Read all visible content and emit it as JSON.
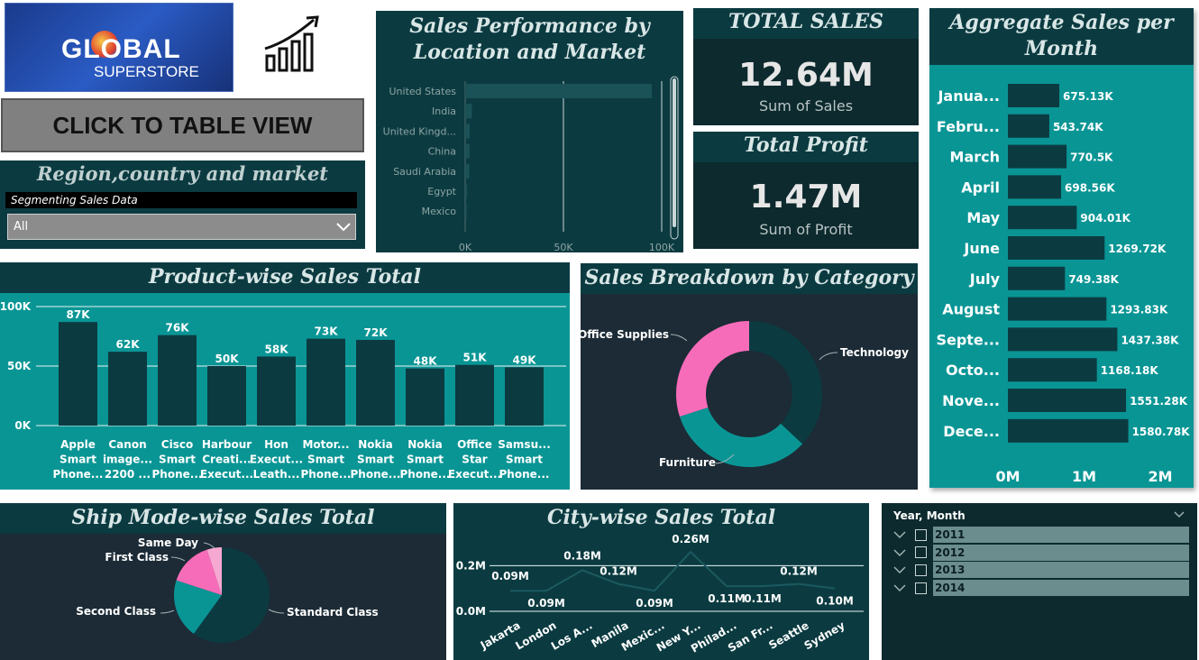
{
  "logo": {
    "line1": "GLOBAL",
    "line2": "SUPERSTORE",
    "icon": "growth-chart-icon"
  },
  "table_button": {
    "label": "CLICK TO TABLE VIEW"
  },
  "region_filter": {
    "title": "Region,country and market",
    "subtitle": "Segmenting Sales Data",
    "selected": "All"
  },
  "location_chart": {
    "title": "Sales Performance by Location and Market",
    "chart_data": {
      "type": "bar",
      "orientation": "horizontal",
      "categories": [
        "United States",
        "India",
        "United Kingd...",
        "China",
        "Saudi Arabia",
        "Egypt",
        "Mexico"
      ],
      "values": [
        95000,
        3400,
        2300,
        2200,
        2100,
        1000,
        800
      ],
      "xticks": [
        "0K",
        "50K",
        "100K"
      ],
      "xlim": [
        0,
        100000
      ]
    }
  },
  "total_sales": {
    "title": "TOTAL SALES",
    "value": "12.64M",
    "caption": "Sum of Sales"
  },
  "total_profit": {
    "title": "Total Profit",
    "value": "1.47M",
    "caption": "Sum of Profit"
  },
  "monthly_chart": {
    "title": "Aggregate Sales per Month",
    "chart_data": {
      "type": "bar",
      "orientation": "horizontal",
      "categories": [
        "Janua...",
        "Febru...",
        "March",
        "April",
        "May",
        "June",
        "July",
        "August",
        "Septe...",
        "Octo...",
        "Nove...",
        "Dece..."
      ],
      "values": [
        675130,
        543740,
        770500,
        698560,
        904010,
        1269720,
        749380,
        1293830,
        1437380,
        1168180,
        1551280,
        1580780
      ],
      "labels": [
        "675.13K",
        "543.74K",
        "770.5K",
        "698.56K",
        "904.01K",
        "1269.72K",
        "749.38K",
        "1293.83K",
        "1437.38K",
        "1168.18K",
        "1551.28K",
        "1580.78K"
      ],
      "xticks": [
        "0M",
        "1M",
        "2M"
      ],
      "xlim": [
        0,
        2000000
      ]
    }
  },
  "product_chart": {
    "title": "Product-wise Sales Total",
    "chart_data": {
      "type": "bar",
      "categories": [
        [
          "Apple",
          "Smart",
          "Phone..."
        ],
        [
          "Canon",
          "image...",
          "2200 ..."
        ],
        [
          "Cisco",
          "Smart",
          "Phone..."
        ],
        [
          "Harbour",
          "Creati...",
          "Execut..."
        ],
        [
          "Hon",
          "Execut...",
          "Leath..."
        ],
        [
          "Motor...",
          "Smart",
          "Phone..."
        ],
        [
          "Nokia",
          "Smart",
          "Phone..."
        ],
        [
          "Nokia",
          "Smart",
          "Phone..."
        ],
        [
          "Office",
          "Star",
          "Execut..."
        ],
        [
          "Samsu...",
          "Smart",
          "Phone..."
        ]
      ],
      "values": [
        87,
        62,
        76,
        50,
        58,
        73,
        72,
        48,
        51,
        49
      ],
      "labels": [
        "87K",
        "62K",
        "76K",
        "50K",
        "58K",
        "73K",
        "72K",
        "48K",
        "51K",
        "49K"
      ],
      "yticks": [
        "100K",
        "50K",
        "0K"
      ],
      "ylim": [
        0,
        100
      ]
    }
  },
  "category_chart": {
    "title": "Sales Breakdown by Category",
    "chart_data": {
      "type": "pie",
      "donut": true,
      "slices": [
        {
          "name": "Technology",
          "value": 37,
          "color": "#0b3b41"
        },
        {
          "name": "Furniture",
          "value": 33,
          "color": "#0a9595"
        },
        {
          "name": "Office Supplies",
          "value": 30,
          "color": "#f76cb8"
        }
      ]
    }
  },
  "shipmode_chart": {
    "title": "Ship Mode-wise Sales Total",
    "chart_data": {
      "type": "pie",
      "slices": [
        {
          "name": "Standard Class",
          "value": 60,
          "color": "#0b3b41"
        },
        {
          "name": "Second Class",
          "value": 20,
          "color": "#0a9595"
        },
        {
          "name": "First Class",
          "value": 15,
          "color": "#f76cb8"
        },
        {
          "name": "Same Day",
          "value": 5,
          "color": "#f7a8d2"
        }
      ]
    }
  },
  "city_chart": {
    "title": "City-wise Sales Total",
    "chart_data": {
      "type": "line",
      "categories": [
        "Jakarta",
        "London",
        "Los A...",
        "Manila",
        "Mexic...",
        "New Y...",
        "Philad...",
        "San Fr...",
        "Seattle",
        "Sydney"
      ],
      "values": [
        0.09,
        0.09,
        0.18,
        0.12,
        0.09,
        0.26,
        0.11,
        0.11,
        0.12,
        0.1
      ],
      "labels": [
        "0.09M",
        "0.09M",
        "0.18M",
        "0.12M",
        "0.09M",
        "0.26M",
        "0.11M",
        "0.11M",
        "0.12M",
        "0.10M"
      ],
      "yticks": [
        "0.2M",
        "0.0M"
      ],
      "ylim": [
        0,
        0.3
      ]
    }
  },
  "date_slicer": {
    "title": "Year, Month",
    "years": [
      "2011",
      "2012",
      "2013",
      "2014"
    ]
  }
}
